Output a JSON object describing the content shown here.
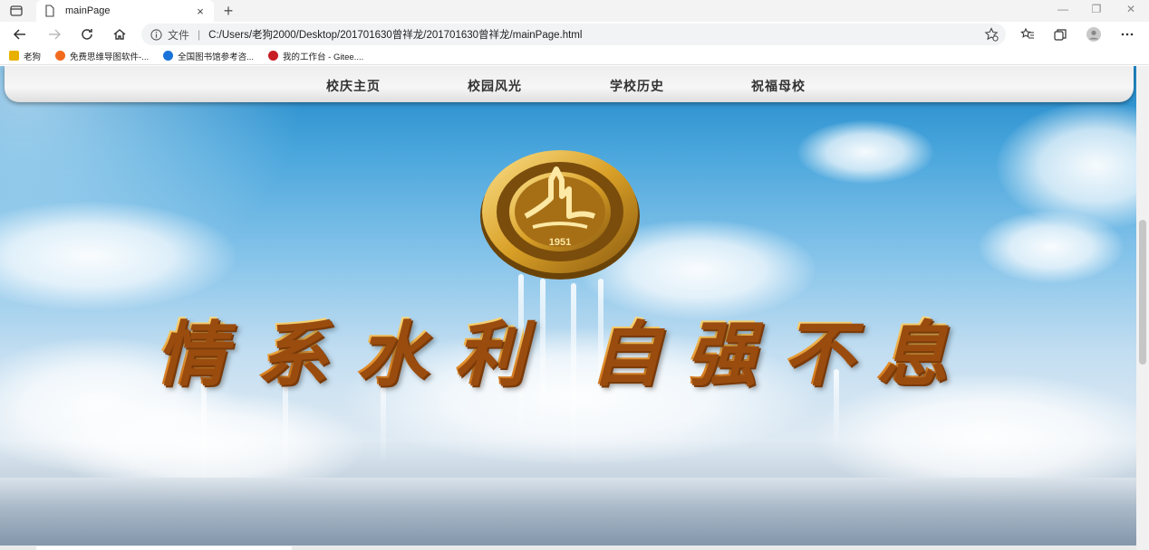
{
  "browser": {
    "tab_title": "mainPage",
    "tab_close": "×",
    "new_tab": "+",
    "minimize": "—",
    "restore": "❐",
    "close": "✕",
    "address_scheme": "文件",
    "address_url": "C:/Users/老狗2000/Desktop/201701630曾祥龙/201701630曾祥龙/mainPage.html",
    "bookmarks": [
      {
        "label": "老狗",
        "icon": "folder-icon",
        "color": "#e8b100"
      },
      {
        "label": "免费思维导图软件-...",
        "icon": "mindmap-site-icon",
        "color": "#f26b1d"
      },
      {
        "label": "全国图书馆参考咨...",
        "icon": "ie-icon",
        "color": "#1a73d9"
      },
      {
        "label": "我的工作台 - Gitee....",
        "icon": "gitee-icon",
        "color": "#c71d23"
      }
    ]
  },
  "page": {
    "nav": [
      "校庆主页",
      "校园风光",
      "学校历史",
      "祝福母校"
    ],
    "emblem": {
      "year": "1951",
      "icon": "university-emblem-icon"
    },
    "slogan": [
      "情",
      "系",
      "水",
      "利",
      "自",
      "强",
      "不",
      "息"
    ]
  },
  "colors": {
    "sky_top": "#1e86c8",
    "navbar": "#efefef",
    "slogan_gold": "#e79a2c",
    "emblem_gold": "#d9a027"
  }
}
